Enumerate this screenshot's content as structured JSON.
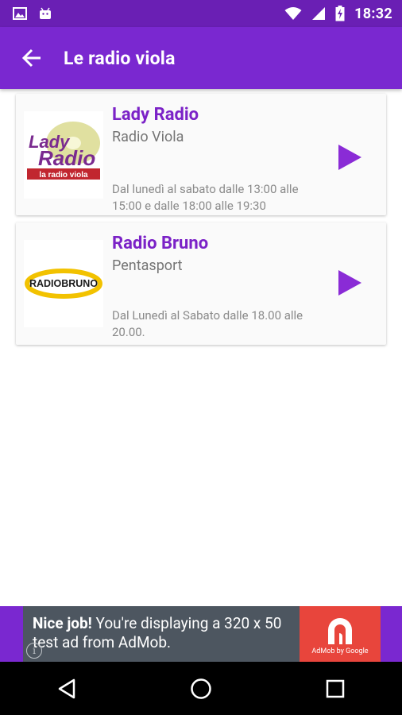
{
  "status_bar": {
    "time": "18:32",
    "left_icons": [
      "image-notification-icon",
      "android-notification-icon"
    ],
    "right_icons": [
      "wifi-icon",
      "cell-signal-icon",
      "battery-charging-icon"
    ]
  },
  "app_bar": {
    "title": "Le radio viola",
    "back_icon": "arrow-back-icon"
  },
  "stations": [
    {
      "name": "Lady Radio",
      "subtitle": "Radio Viola",
      "schedule": "Dal lunedì al sabato dalle 13:00 alle 15:00 e dalle 18:00 alle 19:30",
      "logo": {
        "line1": "Lady",
        "line2": "Radio",
        "tagline": "la radio viola"
      }
    },
    {
      "name": "Radio Bruno",
      "subtitle": "Pentasport",
      "schedule": "Dal Lunedì al Sabato dalle 18.00 alle 20.00.",
      "logo": {
        "text": "RADIOBRUNO"
      }
    }
  ],
  "ad": {
    "headline": "Nice job!",
    "body": " You're displaying a 320 x 50 test ad from AdMob.",
    "logo_caption": "AdMob by Google",
    "info_icon": "info-icon"
  },
  "nav_bar": {
    "icons": [
      "back-triangle-icon",
      "home-circle-icon",
      "recents-square-icon"
    ]
  },
  "colors": {
    "status_bar": "#6a1fb4",
    "app_bar": "#7a28d0",
    "accent": "#7b22c7",
    "ad_background": "#4d5660",
    "ad_logo": "#e8453c"
  }
}
